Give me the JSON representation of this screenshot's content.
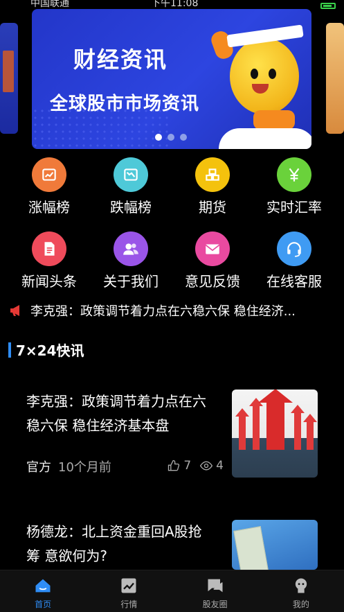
{
  "status_bar": {
    "carrier": "中国联通",
    "time": "下午11:08"
  },
  "banner": {
    "title": "财经资讯",
    "subtitle": "全球股市市场资讯",
    "page_count": 3,
    "active_page": 1
  },
  "grid": {
    "row1": [
      {
        "label": "涨幅榜",
        "icon": "rising-chart-icon",
        "color": "#f07a3a"
      },
      {
        "label": "跌幅榜",
        "icon": "falling-chart-icon",
        "color": "#4ec9d8"
      },
      {
        "label": "期货",
        "icon": "gold-bars-icon",
        "color": "#f4c20d"
      },
      {
        "label": "实时汇率",
        "icon": "yen-exchange-icon",
        "color": "#6ad23b"
      }
    ],
    "row2": [
      {
        "label": "新闻头条",
        "icon": "document-icon",
        "color": "#ef4b5b"
      },
      {
        "label": "关于我们",
        "icon": "users-icon",
        "color": "#9a55e8"
      },
      {
        "label": "意见反馈",
        "icon": "mail-icon",
        "color": "#e94aa0"
      },
      {
        "label": "在线客服",
        "icon": "headset-icon",
        "color": "#3f9bf3"
      }
    ]
  },
  "notice": {
    "text": "李克强：政策调节着力点在六稳六保 稳住经济..."
  },
  "section": {
    "title": "7×24快讯"
  },
  "news": [
    {
      "headline_line1": "李克强：政策调节着力点在六",
      "headline_line2": "稳六保 稳住经济基本盘",
      "source": "官方",
      "time": "10个月前",
      "likes": "7",
      "views": "4"
    },
    {
      "headline_line1": "杨德龙：北上资金重回A股抢",
      "headline_line2": "筹 意欲何为?"
    }
  ],
  "tabbar": [
    {
      "label": "首页",
      "icon": "home-icon",
      "active": true
    },
    {
      "label": "行情",
      "icon": "chart-icon",
      "active": false
    },
    {
      "label": "股友圈",
      "icon": "chat-icon",
      "active": false
    },
    {
      "label": "我的",
      "icon": "profile-icon",
      "active": false
    }
  ],
  "colors": {
    "accent": "#2f8df5",
    "background": "#000000",
    "notice_icon": "#e53935"
  }
}
